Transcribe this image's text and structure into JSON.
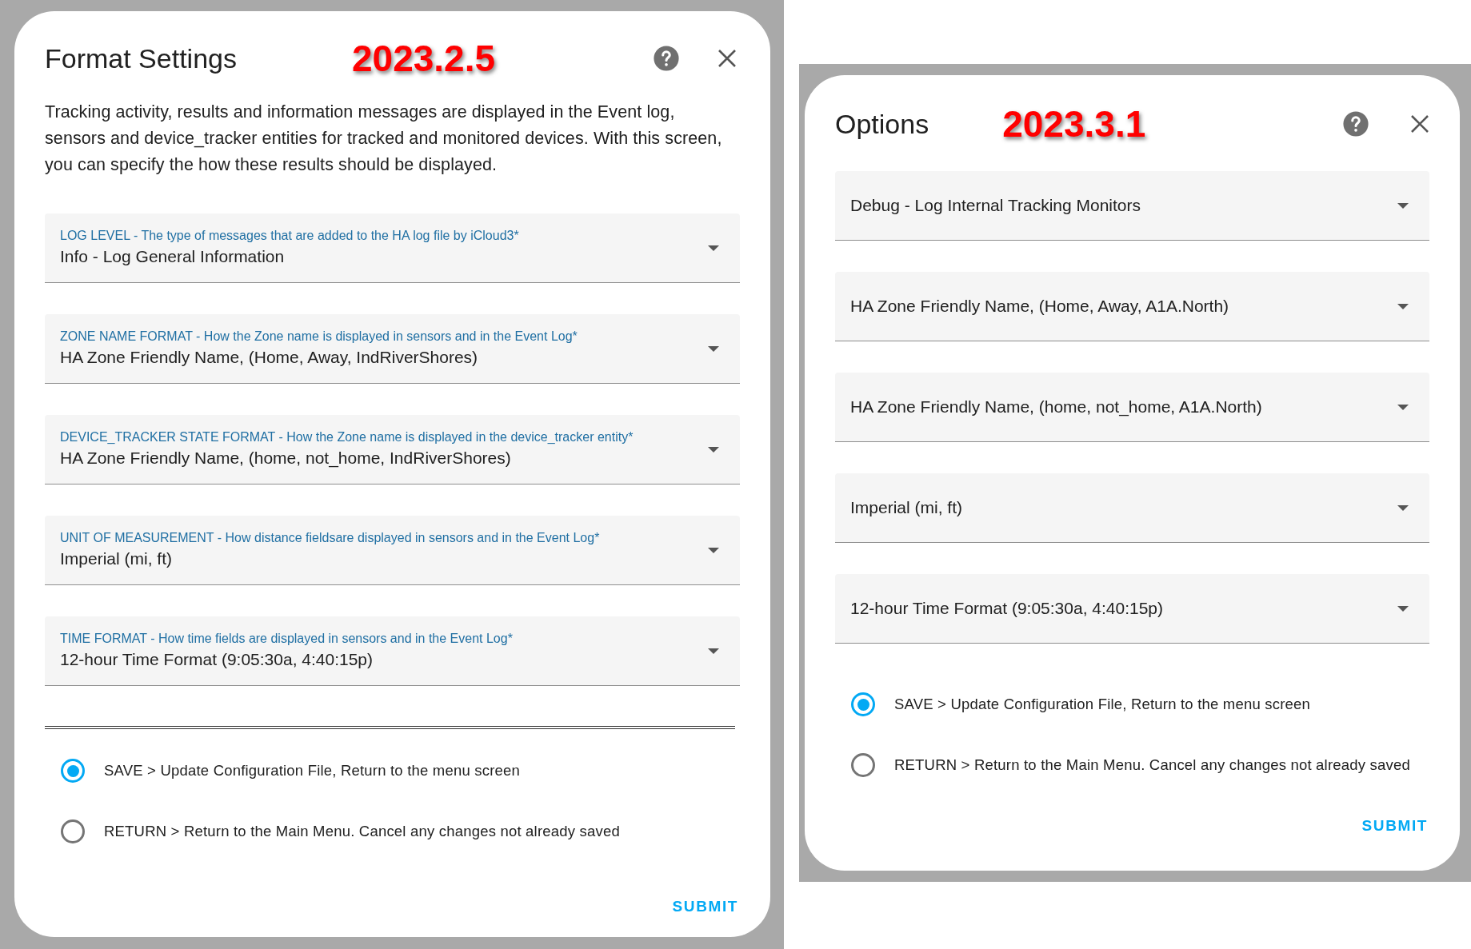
{
  "dialogs": [
    {
      "title": "Format Settings",
      "version": "2023.2.5",
      "description": "Tracking activity, results and information messages are displayed in the Event log, sensors and device_tracker entities for tracked and monitored devices. With this screen, you can specify the how these results should be displayed.",
      "fields": [
        {
          "label": "LOG LEVEL - The type of messages that are added to the HA log file by iCloud3*",
          "value": "Info - Log General Information"
        },
        {
          "label": "ZONE NAME FORMAT - How the Zone name is displayed in sensors and in the Event Log*",
          "value": "HA Zone Friendly Name, (Home, Away, IndRiverShores)"
        },
        {
          "label": "DEVICE_TRACKER STATE FORMAT - How the Zone name is displayed in the device_tracker entity*",
          "value": "HA Zone Friendly Name, (home, not_home, IndRiverShores)"
        },
        {
          "label": "UNIT OF MEASUREMENT - How distance fieldsare displayed in sensors and in the Event Log*",
          "value": "Imperial (mi, ft)"
        },
        {
          "label": "TIME FORMAT - How time fields are displayed in sensors and in the Event Log*",
          "value": "12-hour Time Format (9:05:30a, 4:40:15p)"
        }
      ],
      "separator": true,
      "options": [
        {
          "label": "SAVE > Update Configuration File, Return to the menu screen",
          "selected": true
        },
        {
          "label": "RETURN > Return to the Main Menu. Cancel any changes not already saved",
          "selected": false
        }
      ],
      "submit": "SUBMIT"
    },
    {
      "title": "Options",
      "version": "2023.3.1",
      "fields": [
        {
          "value": "Debug - Log Internal Tracking Monitors"
        },
        {
          "value": "HA Zone Friendly Name, (Home, Away, A1A.North)"
        },
        {
          "value": "HA Zone Friendly Name, (home, not_home, A1A.North)"
        },
        {
          "value": "Imperial (mi, ft)"
        },
        {
          "value": "12-hour Time Format (9:05:30a, 4:40:15p)"
        }
      ],
      "separator": false,
      "options": [
        {
          "label": "SAVE > Update Configuration File, Return to the menu screen",
          "selected": true
        },
        {
          "label": "RETURN > Return to the Main Menu. Cancel any changes not already saved",
          "selected": false
        }
      ],
      "submit": "SUBMIT"
    }
  ]
}
